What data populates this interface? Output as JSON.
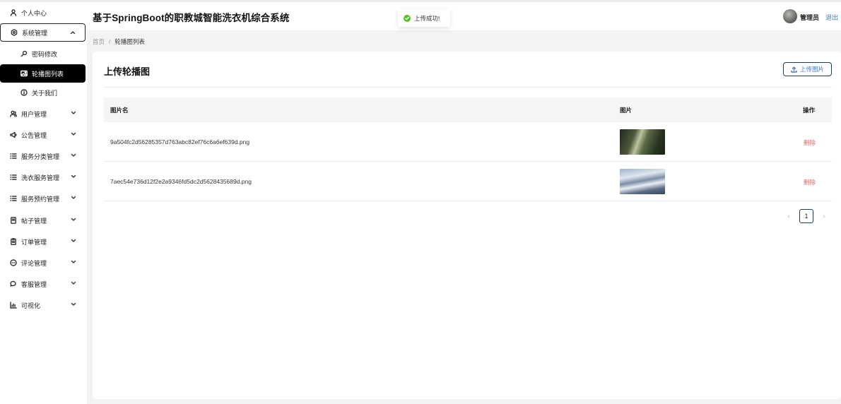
{
  "header": {
    "app_title": "基于SpringBoot的职教城智能洗衣机综合系统",
    "user_name": "管理员",
    "logout_label": "退出"
  },
  "toast": {
    "message": "上传成功!",
    "icon": "check-circle-icon",
    "color": "#52c41a"
  },
  "sidebar": {
    "items": [
      {
        "label": "个人中心",
        "icon": "user-icon"
      },
      {
        "label": "系统管理",
        "icon": "settings-icon",
        "expanded": true
      },
      {
        "label": "密码修改",
        "icon": "key-icon"
      },
      {
        "label": "轮播图列表",
        "icon": "image-icon",
        "active": true
      },
      {
        "label": "关于我们",
        "icon": "info-icon"
      },
      {
        "label": "用户管理",
        "icon": "users-icon"
      },
      {
        "label": "公告管理",
        "icon": "megaphone-icon"
      },
      {
        "label": "服务分类管理",
        "icon": "list-icon"
      },
      {
        "label": "洗衣服务管理",
        "icon": "list-icon"
      },
      {
        "label": "服务预约管理",
        "icon": "list-icon"
      },
      {
        "label": "帖子管理",
        "icon": "document-icon"
      },
      {
        "label": "订单管理",
        "icon": "clipboard-icon"
      },
      {
        "label": "评论管理",
        "icon": "comment-icon"
      },
      {
        "label": "客服管理",
        "icon": "chat-icon"
      },
      {
        "label": "可视化",
        "icon": "bar-chart-icon"
      }
    ]
  },
  "breadcrumb": {
    "home": "首页",
    "separator": "/",
    "current": "轮播图列表"
  },
  "main": {
    "title": "上传轮播图",
    "upload_button": "上传图片",
    "columns": {
      "name": "图片名",
      "image": "图片",
      "action": "操作"
    },
    "rows": [
      {
        "name": "9a504fc2d56285357d763abc82ef76c6a6ef639d.png",
        "thumbnail": "forest-light-image",
        "action": "删除"
      },
      {
        "name": "7aec54e736d12f2e2a9346fd5dc2d56284356 89d.png",
        "thumbnail": "snowy-mountain-image",
        "action": "删除"
      }
    ],
    "pagination": {
      "prev": "‹",
      "current_page": "1",
      "next": "›"
    }
  },
  "colors": {
    "active_nav": "#000000",
    "link": "#3a7bd5",
    "delete": "#e06666"
  }
}
